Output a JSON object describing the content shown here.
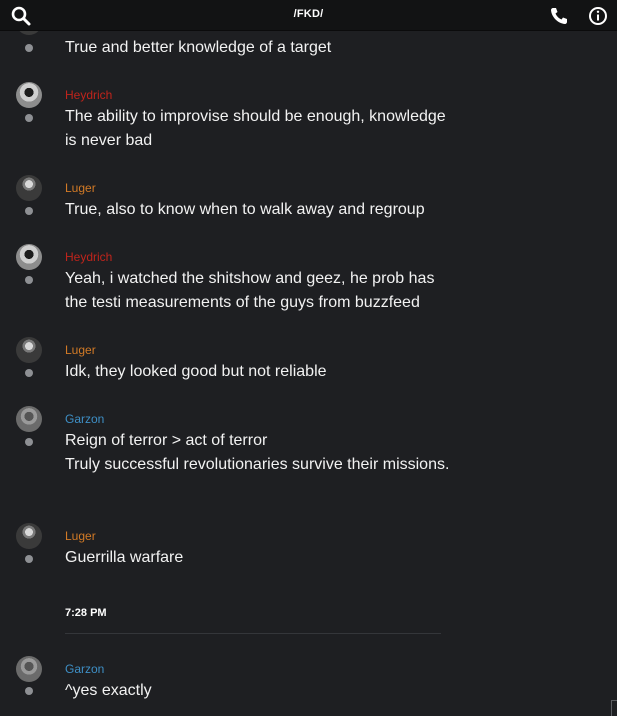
{
  "header": {
    "title": "/FKD/",
    "search_icon": "search-icon",
    "phone_icon": "phone-icon",
    "info_icon": "info-icon"
  },
  "colors": {
    "heydrich": "#c0241c",
    "luger": "#d27a26",
    "garzon": "#3e8fc6"
  },
  "messages": [
    {
      "author": "",
      "text": "True and better knowledge of a target"
    },
    {
      "author": "Heydrich",
      "text": "The ability to improvise should be enough, knowledge is never bad"
    },
    {
      "author": "Luger",
      "text": "True, also to know when to walk away and regroup"
    },
    {
      "author": "Heydrich",
      "text": "Yeah, i watched the shitshow and geez, he prob has the testi measurements of the guys from buzzfeed"
    },
    {
      "author": "Luger",
      "text": "Idk, they looked good but not reliable"
    },
    {
      "author": "Garzon",
      "lines": [
        "Reign of terror > act of terror",
        "Truly successful revolutionaries survive their missions."
      ]
    },
    {
      "author": "Luger",
      "text": "Guerrilla warfare"
    },
    {
      "author": "Garzon",
      "text": "^yes exactly"
    }
  ],
  "time_separator": "7:28 PM"
}
